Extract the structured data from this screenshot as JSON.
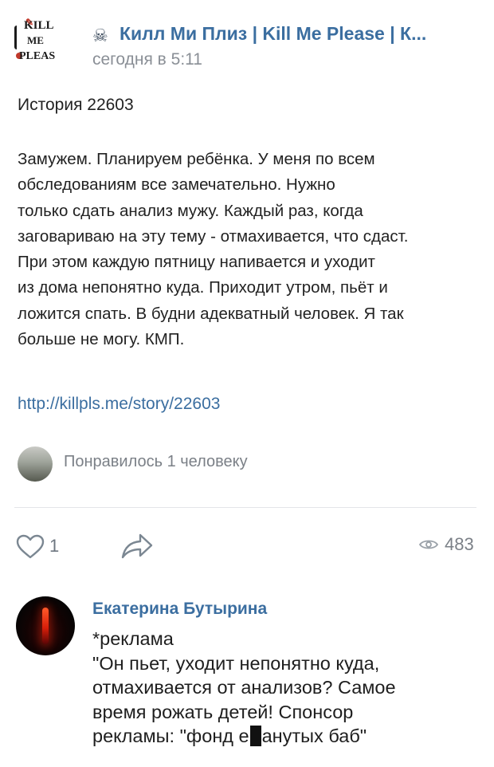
{
  "post": {
    "group_logo_text": "KILL ME PLEASE",
    "group_name": "Килл Ми Плиз | Kill Me Please | К...",
    "time": "сегодня в 5:11",
    "title": "История 22603",
    "body_lines": [
      "Замужем. Планируем ребёнка. У меня по всем",
      "обследованиям все замечательно. Нужно",
      "только сдать анализ мужу. Каждый раз, когда",
      "заговариваю на эту тему - отмахивается, что сдаст.",
      "При этом каждую пятницу напивается и уходит",
      "из дома непонятно куда. Приходит утром, пьёт и",
      "ложится спать. В будни адекватный человек. Я так",
      "больше не могу. КМП."
    ],
    "link": "http://killpls.me/story/22603",
    "liked_by": "Понравилось 1 человеку"
  },
  "actions": {
    "like_count": "1",
    "view_count": "483"
  },
  "comment": {
    "author": "Екатерина Бутырина",
    "lines": [
      "*реклама",
      "\"Он пьет, уходит непонятно куда,",
      "отмахивается от анализов? Самое",
      "время рожать детей! Спонсор"
    ],
    "last_line_start": "рекламы: \"фонд е",
    "last_line_end": "анутых баб\""
  },
  "colors": {
    "link_blue": "#3b6ea0",
    "muted_gray": "#8a8f96",
    "text": "#222222"
  }
}
